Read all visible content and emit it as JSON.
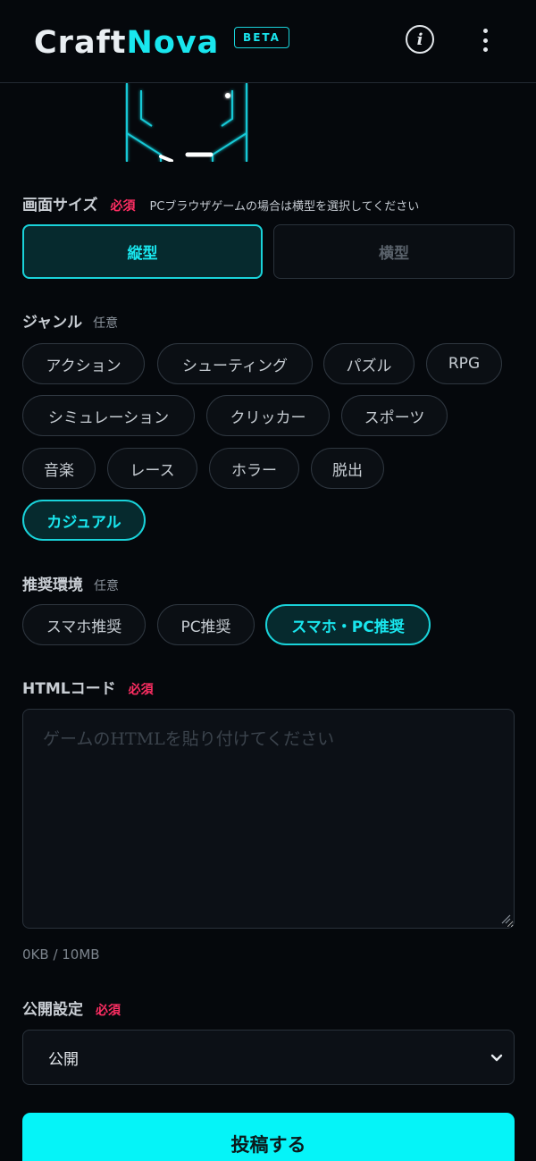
{
  "app": {
    "logo_a": "Craft",
    "logo_b": "Nova",
    "badge": "BETA",
    "info_glyph": "i",
    "accent": "#19e6ee"
  },
  "screen_size": {
    "label": "画面サイズ",
    "required": "必須",
    "hint": "PCブラウザゲームの場合は横型を選択してください",
    "options": [
      "縦型",
      "横型"
    ],
    "selected": "縦型"
  },
  "genre": {
    "label": "ジャンル",
    "optional": "任意",
    "chips": [
      "アクション",
      "シューティング",
      "パズル",
      "RPG",
      "シミュレーション",
      "クリッカー",
      "スポーツ",
      "音楽",
      "レース",
      "ホラー",
      "脱出",
      "カジュアル"
    ],
    "selected": "カジュアル"
  },
  "env": {
    "label": "推奨環境",
    "optional": "任意",
    "chips": [
      "スマホ推奨",
      "PC推奨",
      "スマホ・PC推奨"
    ],
    "selected": "スマホ・PC推奨"
  },
  "html_code": {
    "label": "HTMLコード",
    "required": "必須",
    "placeholder": "ゲームのHTMLを貼り付けてください",
    "size": "0KB / 10MB"
  },
  "visibility": {
    "label": "公開設定",
    "required": "必須",
    "value": "公開"
  },
  "submit_label": "投稿する"
}
